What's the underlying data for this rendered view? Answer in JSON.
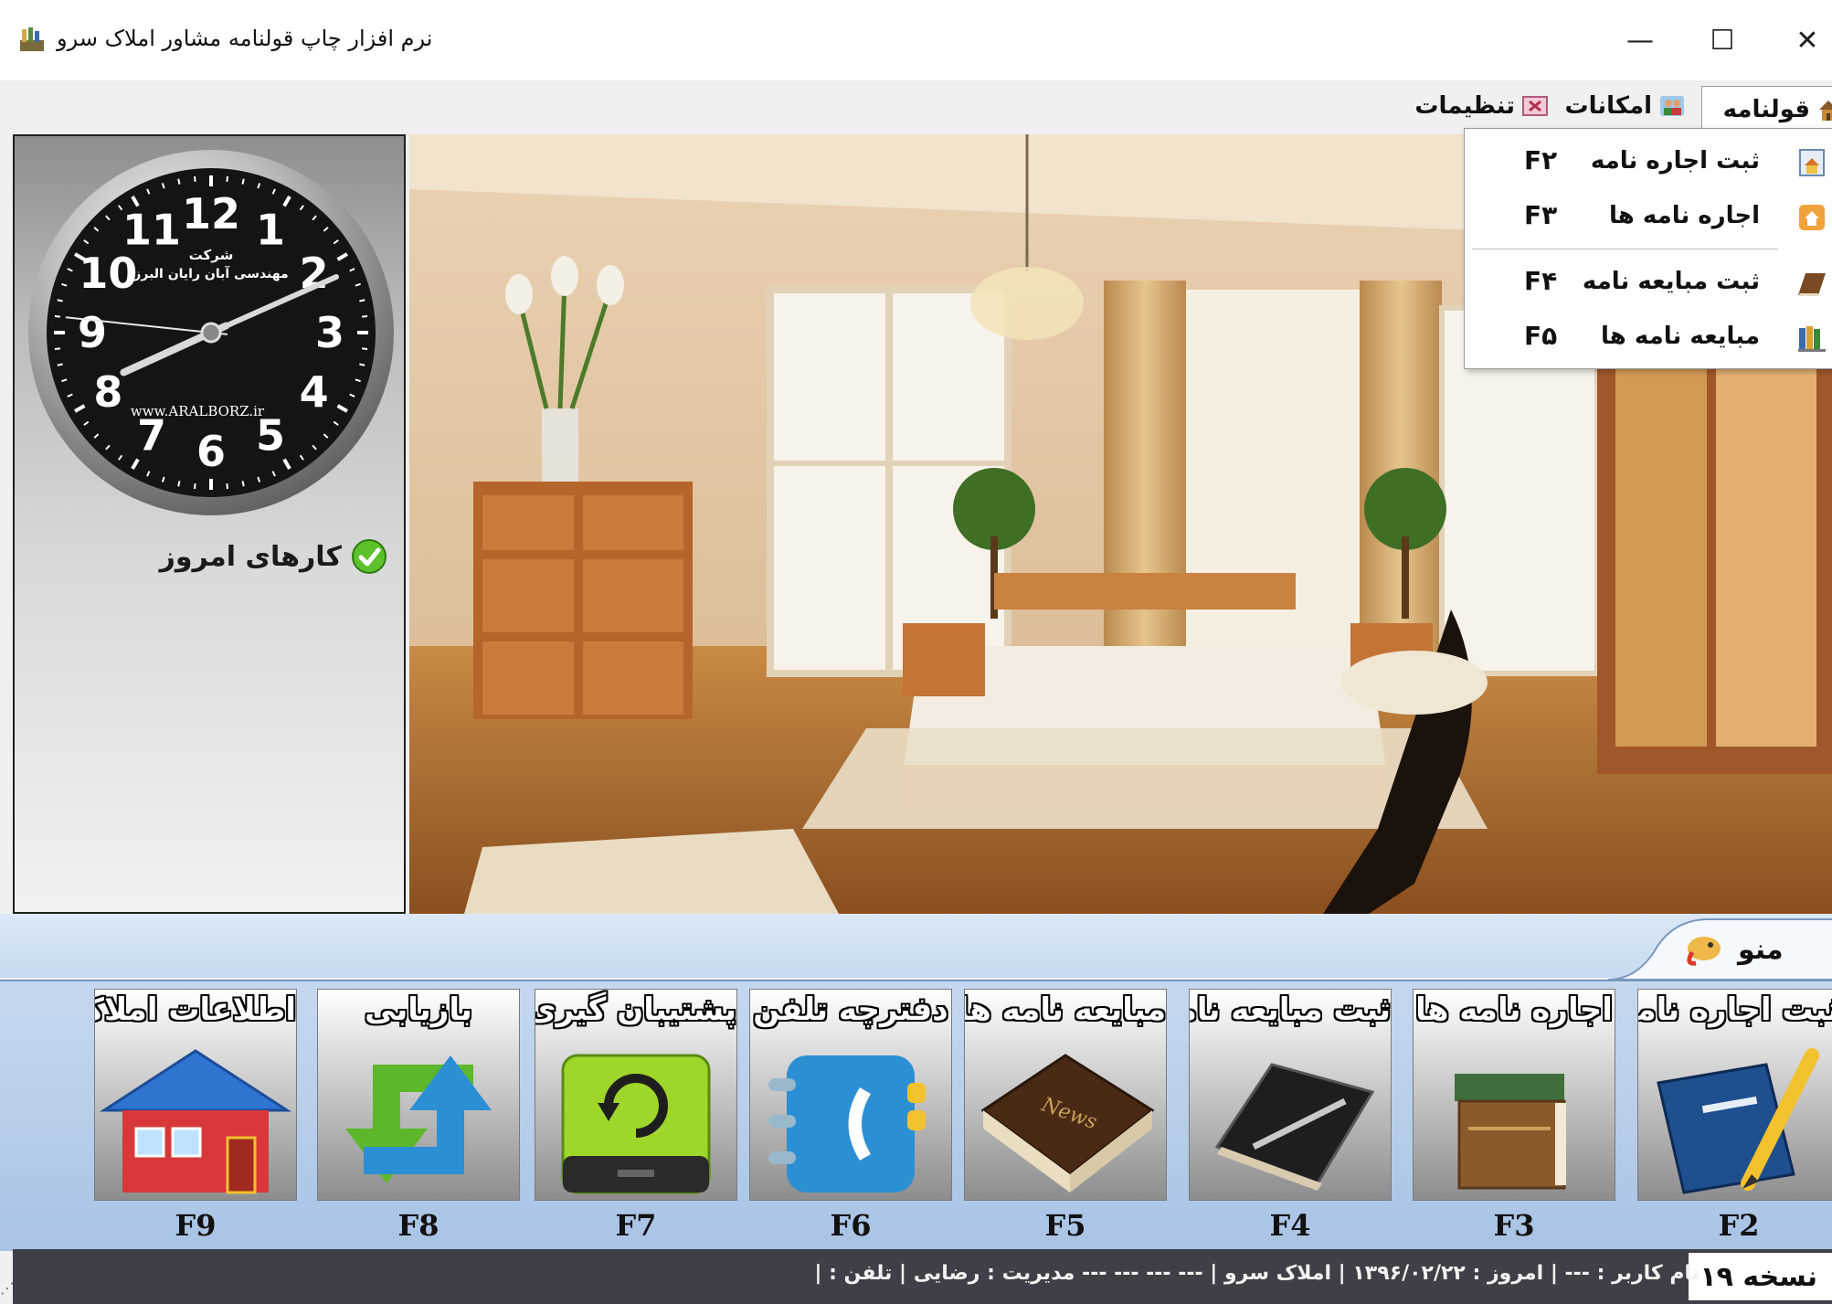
{
  "window": {
    "title": "نرم افزار چاپ قولنامه مشاور املاک سرو",
    "minimize": "—",
    "maximize": "☐",
    "close": "✕"
  },
  "menubar": {
    "items": [
      {
        "label": "قولنامه",
        "icon": "houses-icon"
      },
      {
        "label": "امکانات",
        "icon": "users-icon"
      },
      {
        "label": "تنظیمات",
        "icon": "settings-window-icon"
      }
    ]
  },
  "dropdown": {
    "items": [
      {
        "label": "ثبت اجاره نامه",
        "shortcut": "F۲",
        "icon": "document-house-icon"
      },
      {
        "label": "اجاره نامه ها",
        "shortcut": "F۳",
        "icon": "home-icon"
      },
      {
        "label": "ثبت مبایعه نامه",
        "shortcut": "F۴",
        "icon": "book-icon"
      },
      {
        "label": "مبایعه نامه ها",
        "shortcut": "F۵",
        "icon": "books-icon"
      }
    ]
  },
  "clock": {
    "company": "شرکت",
    "company_name": "مهندسی آبان رایان البرز",
    "website": "www.ARALBORZ.ir",
    "hour": 8,
    "minute": 11,
    "second": 46
  },
  "today_tasks": {
    "label": "کارهای امروز",
    "icon": "check-circle-icon"
  },
  "menu_tab": {
    "label": "منو",
    "icon": "menu-bird-icon"
  },
  "tiles": [
    {
      "label": "ثبت اجاره نامه",
      "key": "F2",
      "icon": "notebook-pencil-icon"
    },
    {
      "label": "اجاره نامه ها",
      "key": "F3",
      "icon": "books-stack-icon"
    },
    {
      "label": "ثبت مبایعه نامه",
      "key": "F4",
      "icon": "black-notebook-pen-icon"
    },
    {
      "label": "مبایعه نامه ها",
      "key": "F5",
      "icon": "leather-book-icon"
    },
    {
      "label": "دفترچه تلفن",
      "key": "F6",
      "icon": "phonebook-icon"
    },
    {
      "label": "پشتیبان گیری",
      "key": "F7",
      "icon": "backup-drive-icon"
    },
    {
      "label": "بازیابی",
      "key": "F8",
      "icon": "restore-arrows-icon"
    },
    {
      "label": "اطلاعات املاک",
      "key": "F9",
      "icon": "house-icon"
    }
  ],
  "statusbar": {
    "version": "نسخه ۱۹",
    "details": "نام کاربر : ---  |  امروز : ۱۳۹۶/۰۲/۲۲  |  املاک سرو  |  --- --- --- ---  مدیریت : رضایی  |  تلفن :  |"
  },
  "colors": {
    "status_bg": "#3f4047",
    "tile_strip": "#b7cdea",
    "clock_face": "#141414"
  }
}
